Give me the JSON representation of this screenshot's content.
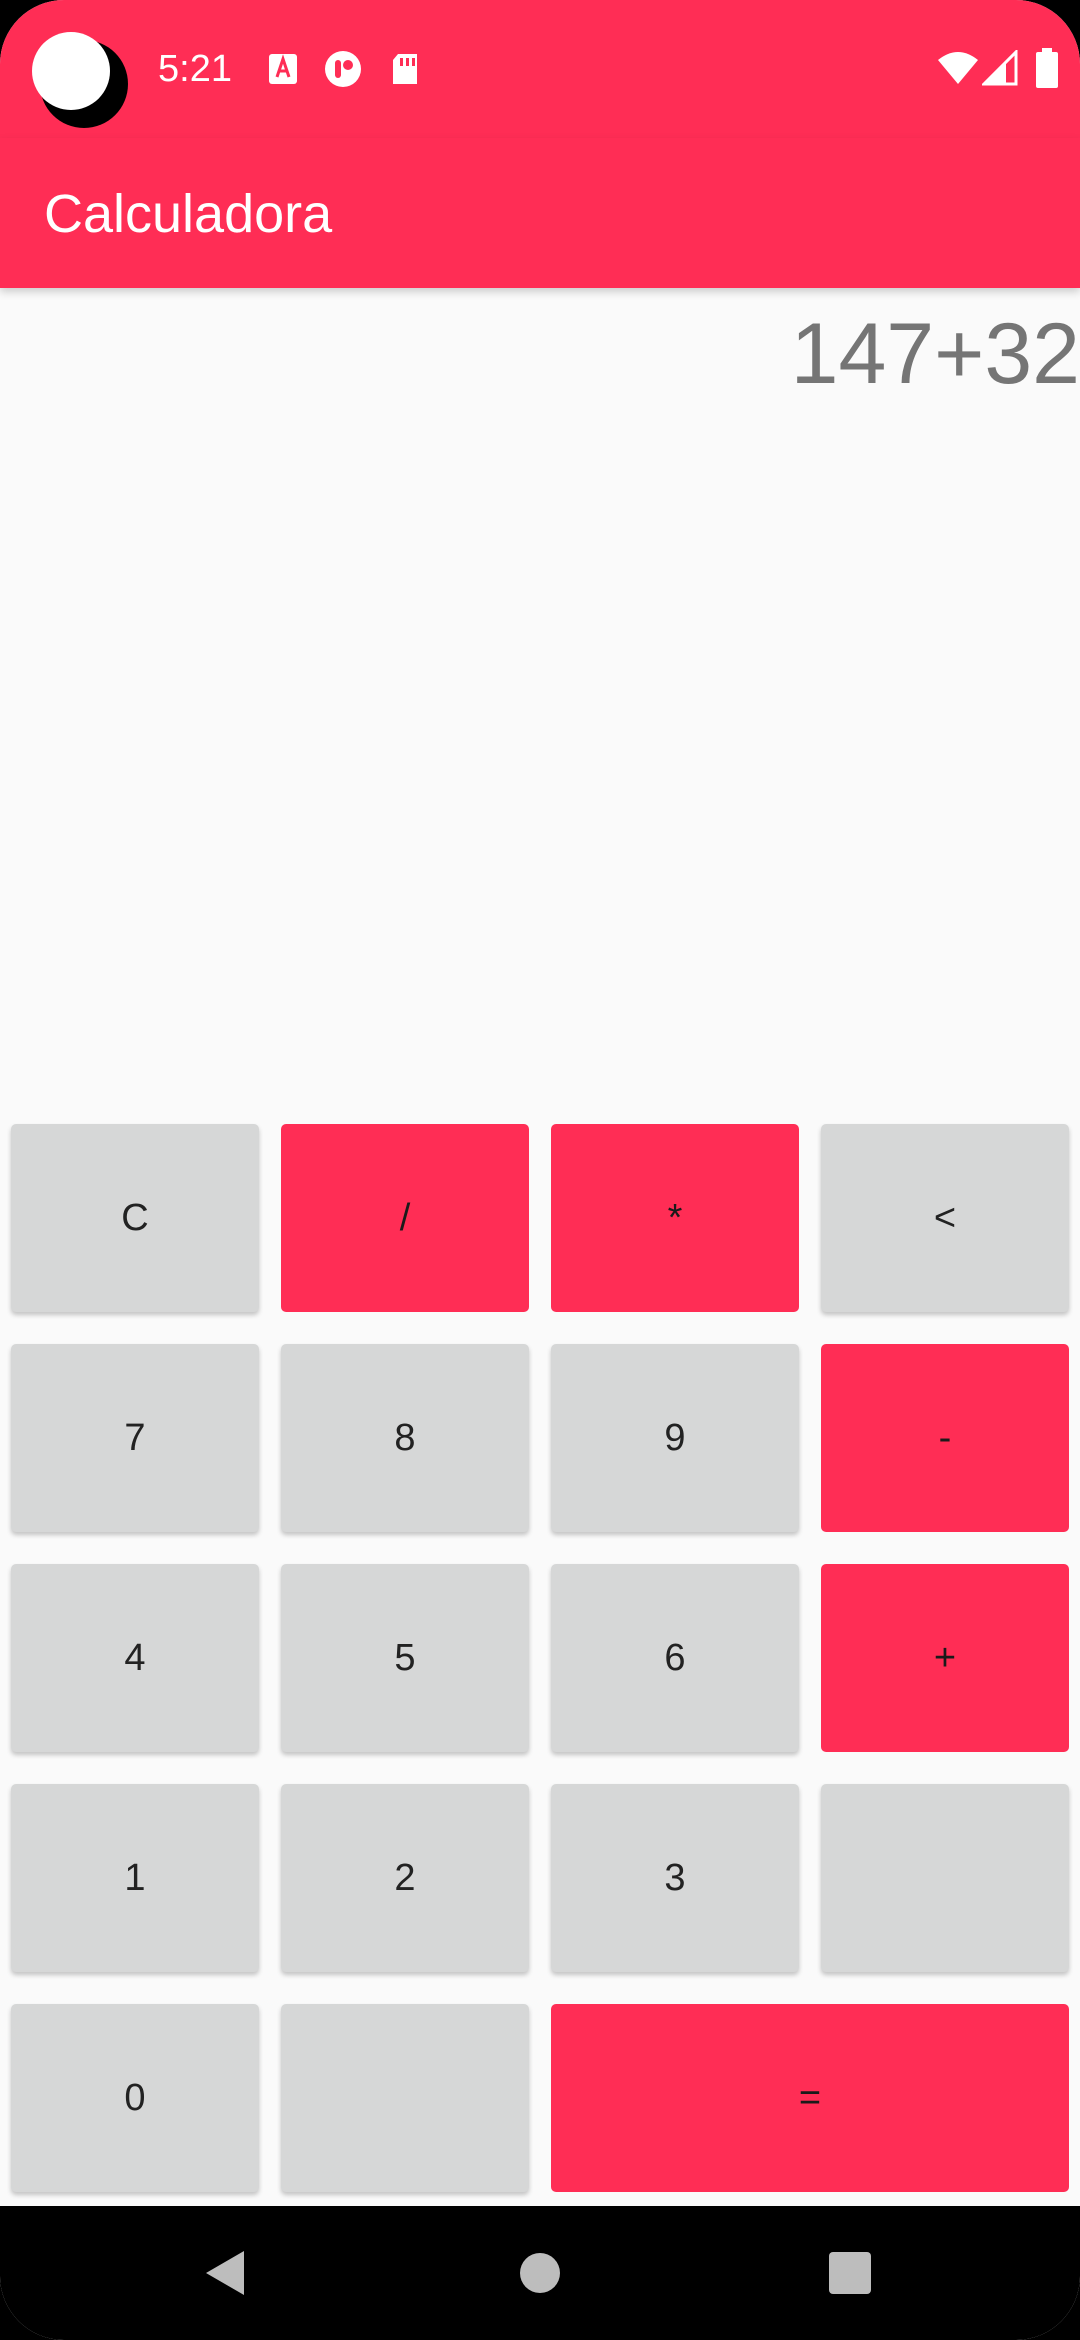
{
  "status_bar": {
    "time": "5:21",
    "icons": [
      "app-notification-icon",
      "media-notification-icon",
      "sd-card-icon",
      "wifi-icon",
      "cell-signal-icon",
      "battery-icon"
    ]
  },
  "app_bar": {
    "title": "Calculadora"
  },
  "display": {
    "expression": "147+32"
  },
  "keypad": {
    "clear": "C",
    "divide": "/",
    "multiply": "*",
    "backspace": "<",
    "seven": "7",
    "eight": "8",
    "nine": "9",
    "minus": "-",
    "four": "4",
    "five": "5",
    "six": "6",
    "plus": "+",
    "one": "1",
    "two": "2",
    "three": "3",
    "blank_right": "",
    "zero": "0",
    "blank_bottom": "",
    "equals": "="
  },
  "nav_bar": {
    "icons": [
      "back-icon",
      "home-icon",
      "recents-icon"
    ]
  },
  "colors": {
    "accent": "#ff2d55",
    "key_gray": "#d6d7d7",
    "display_text": "#757575",
    "background": "#fafafa"
  }
}
